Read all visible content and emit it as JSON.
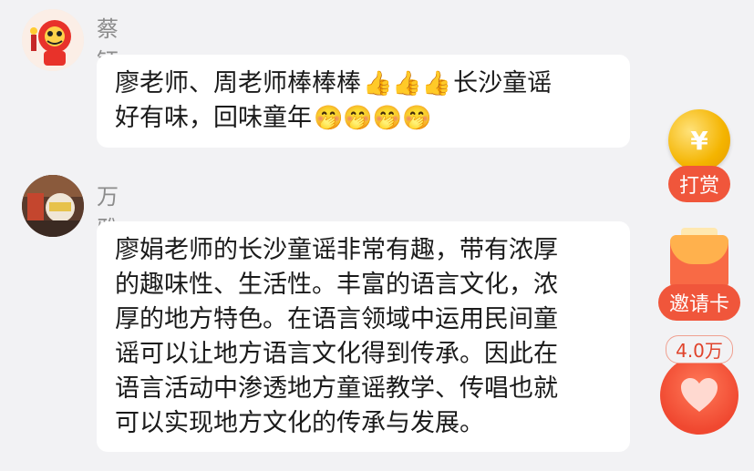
{
  "messages": [
    {
      "name": "蔡钰",
      "avatar": "lion-dance-avatar",
      "text_parts": [
        "廖老师、周老师棒棒棒",
        "长沙童谣",
        "好有味，回味童年"
      ],
      "emoji_thumbs": "👍👍👍",
      "emoji_faces": "🤭🤭🤭🤭"
    },
    {
      "name": "万雅",
      "avatar": "photo-avatar",
      "lines": [
        "廖娟老师的长沙童谣非常有趣，带有浓厚",
        "的趣味性、生活性。丰富的语言文化，浓",
        "厚的地方特色。在语言领域中运用民间童",
        "谣可以让地方语言文化得到传承。因此在",
        "语言活动中渗透地方童谣教学、传唱也就",
        "可以实现地方文化的传承与发展。"
      ]
    }
  ],
  "sidebar": {
    "tip": {
      "icon": "yuan-coin-icon",
      "symbol": "¥",
      "label": "打赏"
    },
    "invite": {
      "icon": "red-envelope-icon",
      "label": "邀请卡"
    },
    "like": {
      "icon": "heart-icon",
      "count": "4.0万"
    }
  },
  "colors": {
    "accent": "#f0563b",
    "background": "#f2f2f4",
    "bubble": "#ffffff"
  }
}
